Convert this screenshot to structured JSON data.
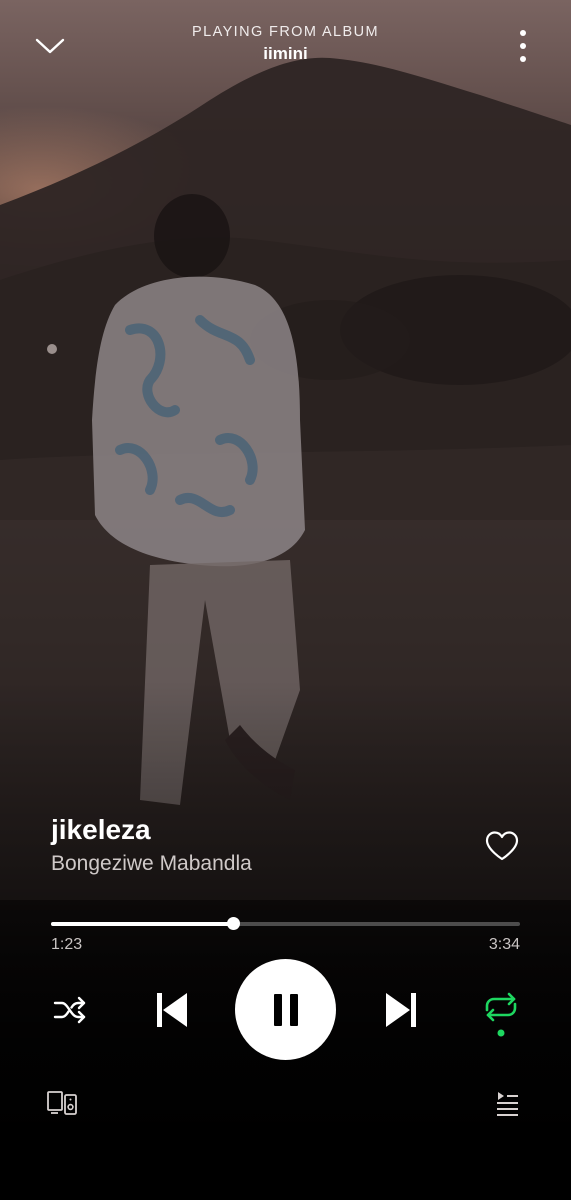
{
  "header": {
    "context_label": "PLAYING FROM ALBUM",
    "album_name": "iimini"
  },
  "track": {
    "title": "jikeleza",
    "artist": "Bongeziwe Mabandla",
    "liked": false
  },
  "playback": {
    "elapsed": "1:23",
    "duration": "3:34",
    "progress_fraction": 0.388,
    "is_playing": true,
    "shuffle": false,
    "repeat": "all"
  },
  "colors": {
    "accent": "#1ed760",
    "text_primary": "#ffffff",
    "text_secondary": "#cfc9c8"
  },
  "icons": {
    "collapse": "chevron-down-icon",
    "more": "more-vertical-icon",
    "like": "heart-icon",
    "shuffle": "shuffle-icon",
    "previous": "skip-previous-icon",
    "play_pause": "pause-icon",
    "next": "skip-next-icon",
    "repeat": "repeat-icon",
    "devices": "devices-icon",
    "queue": "queue-icon"
  }
}
